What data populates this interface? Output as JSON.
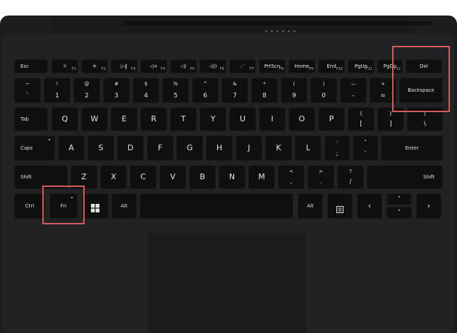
{
  "keys": {
    "esc": "Esc",
    "f1": "F1",
    "f2": "F2",
    "f3": "F3",
    "f4": "F4",
    "f5": "F5",
    "f6": "F6",
    "f7": "F7",
    "f8": "F8",
    "f9": "F9",
    "f10": "F10",
    "f11": "F11",
    "f12": "F12",
    "prtscn": "PrtScn",
    "home": "Home",
    "end": "End",
    "pgup": "PgUp",
    "pgdn": "PgDn",
    "del": "Del",
    "backtick_top": "~",
    "backtick_bot": "`",
    "n1_top": "!",
    "n1": "1",
    "n2_top": "@",
    "n2": "2",
    "n3_top": "#",
    "n3": "3",
    "n4_top": "$",
    "n4": "4",
    "n5_top": "%",
    "n5": "5",
    "n6_top": "^",
    "n6": "6",
    "n7_top": "&",
    "n7": "7",
    "n8_top": "*",
    "n8": "8",
    "n9_top": "(",
    "n9": "9",
    "n0_top": ")",
    "n0": "0",
    "minus_top": "—",
    "minus": "-",
    "plus_top": "+",
    "plus": "=",
    "backspace": "Backspace",
    "tab": "Tab",
    "q": "Q",
    "w": "W",
    "e": "E",
    "r": "R",
    "t": "T",
    "y": "Y",
    "u": "U",
    "i": "I",
    "o": "O",
    "p": "P",
    "lbrace_top": "{",
    "lbrace": "[",
    "rbrace_top": "}",
    "rbrace": "]",
    "pipe_top": "|",
    "pipe": "\\",
    "caps": "Caps",
    "a": "A",
    "s": "S",
    "d": "D",
    "f": "F",
    "g": "G",
    "h": "H",
    "j": "J",
    "k": "K",
    "l": "L",
    "colon_top": ":",
    "colon": ";",
    "quote_top": "\"",
    "quote": "'",
    "enter": "Enter",
    "shift": "Shift",
    "z": "Z",
    "x": "X",
    "c": "C",
    "v": "V",
    "b": "B",
    "n": "N",
    "m": "M",
    "lt_top": "<",
    "lt": ",",
    "gt_top": ">",
    "gt": ".",
    "q_top": "?",
    "q_bot": "/",
    "ctrl": "Ctrl",
    "fn": "Fn",
    "alt": "Alt",
    "left": "‹",
    "right": "›",
    "up": "˄",
    "down": "˅"
  },
  "fn_icons": {
    "f1": "☼",
    "f2": "☀",
    "f3": "▷‖",
    "f4": "◁×",
    "f5": "◁)",
    "f6": "◁))",
    "f7": "⋰"
  },
  "highlights": [
    "del",
    "backspace",
    "fn"
  ],
  "colors": {
    "highlight": "#d95a5a",
    "key": "#0f0f10",
    "body": "#1d1d1f"
  }
}
